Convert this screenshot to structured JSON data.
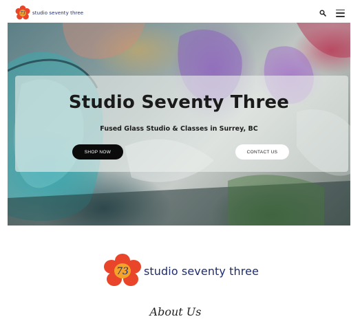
{
  "header": {
    "brand_text": "studio seventy three",
    "logo_number": "73",
    "search_icon": "search-icon",
    "menu_icon": "hamburger-menu-icon"
  },
  "hero": {
    "title": "Studio Seventy Three",
    "subtitle": "Fused Glass Studio & Classes in Surrey, BC",
    "shop_button": "SHOP NOW",
    "contact_button": "CONTACT US"
  },
  "logo_section": {
    "logo_number": "73",
    "logo_text": "studio seventy three"
  },
  "about": {
    "title": "About Us"
  },
  "colors": {
    "brand_navy": "#1f2c6e",
    "flower_red": "#e8452a",
    "flower_orange": "#f3a32a",
    "button_dark": "#0b0b0b"
  }
}
